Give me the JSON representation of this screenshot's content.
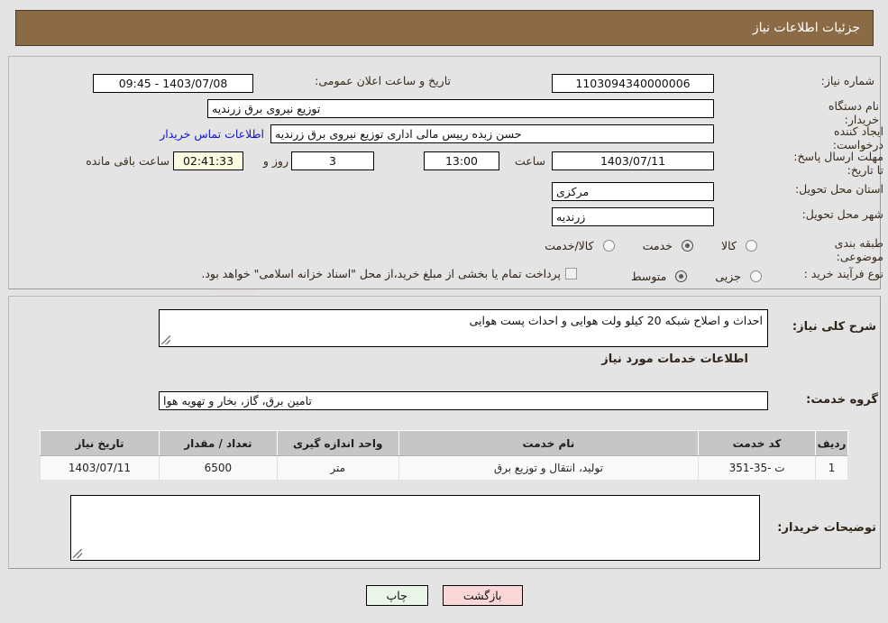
{
  "header": {
    "title": "جزئیات اطلاعات نیاز"
  },
  "watermark": {
    "text": "AriaTender.net"
  },
  "form": {
    "need_number": {
      "label": "شماره نیاز:",
      "value": "1103094340000006"
    },
    "announce_datetime": {
      "label": "تاریخ و ساعت اعلان عمومی:",
      "value": "1403/07/08 - 09:45"
    },
    "buyer_org": {
      "label": "نام دستگاه خریدار:",
      "value": "توزیع نیروی برق زرندیه"
    },
    "requester": {
      "label": "ایجاد کننده درخواست:",
      "value": "حسن زبده رییس مالی اداری توزیع نیروی برق زرندیه"
    },
    "contact_link": {
      "label": "اطلاعات تماس خریدار"
    },
    "deadline": {
      "label": "مهلت ارسال پاسخ: تا تاریخ:",
      "date": "1403/07/11",
      "time_label": "ساعت",
      "time": "13:00",
      "days": "3",
      "days_label": "روز و",
      "countdown": "02:41:33",
      "countdown_label": "ساعت باقی مانده"
    },
    "province": {
      "label": "استان محل تحویل:",
      "value": "مرکزی"
    },
    "city": {
      "label": "شهر محل تحویل:",
      "value": "زرندیه"
    },
    "classification": {
      "label": "طبقه بندی موضوعی:",
      "options": [
        {
          "label": "کالا",
          "selected": false
        },
        {
          "label": "خدمت",
          "selected": true
        },
        {
          "label": "کالا/خدمت",
          "selected": false
        }
      ]
    },
    "purchase_type": {
      "label": "نوع فرآیند خرید :",
      "options": [
        {
          "label": "جزیی",
          "selected": false
        },
        {
          "label": "متوسط",
          "selected": true
        }
      ],
      "checkbox_checked": false,
      "checkbox_label": "پرداخت تمام یا بخشی از مبلغ خرید،از محل \"اسناد خزانه اسلامی\" خواهد بود."
    }
  },
  "need_description": {
    "label": "شرح کلی نیاز:",
    "value": "احداث و اصلاح شبکه 20 کیلو ولت هوایی و احداث پست هوایی"
  },
  "services_section": {
    "title": "اطلاعات خدمات مورد نیاز",
    "service_group": {
      "label": "گروه خدمت:",
      "value": "تامین برق، گاز، بخار و تهویه هوا"
    }
  },
  "table": {
    "headers": [
      "ردیف",
      "کد خدمت",
      "نام خدمت",
      "واحد اندازه گیری",
      "تعداد / مقدار",
      "تاریخ نیاز"
    ],
    "rows": [
      {
        "row_no": "1",
        "service_code": "ت -35-351",
        "service_name": "تولید، انتقال و توزیع برق",
        "unit": "متر",
        "quantity": "6500",
        "need_date": "1403/07/11"
      }
    ]
  },
  "buyer_notes": {
    "label": "توضیحات خریدار:",
    "value": ""
  },
  "buttons": {
    "print": "چاپ",
    "back": "بازگشت"
  }
}
